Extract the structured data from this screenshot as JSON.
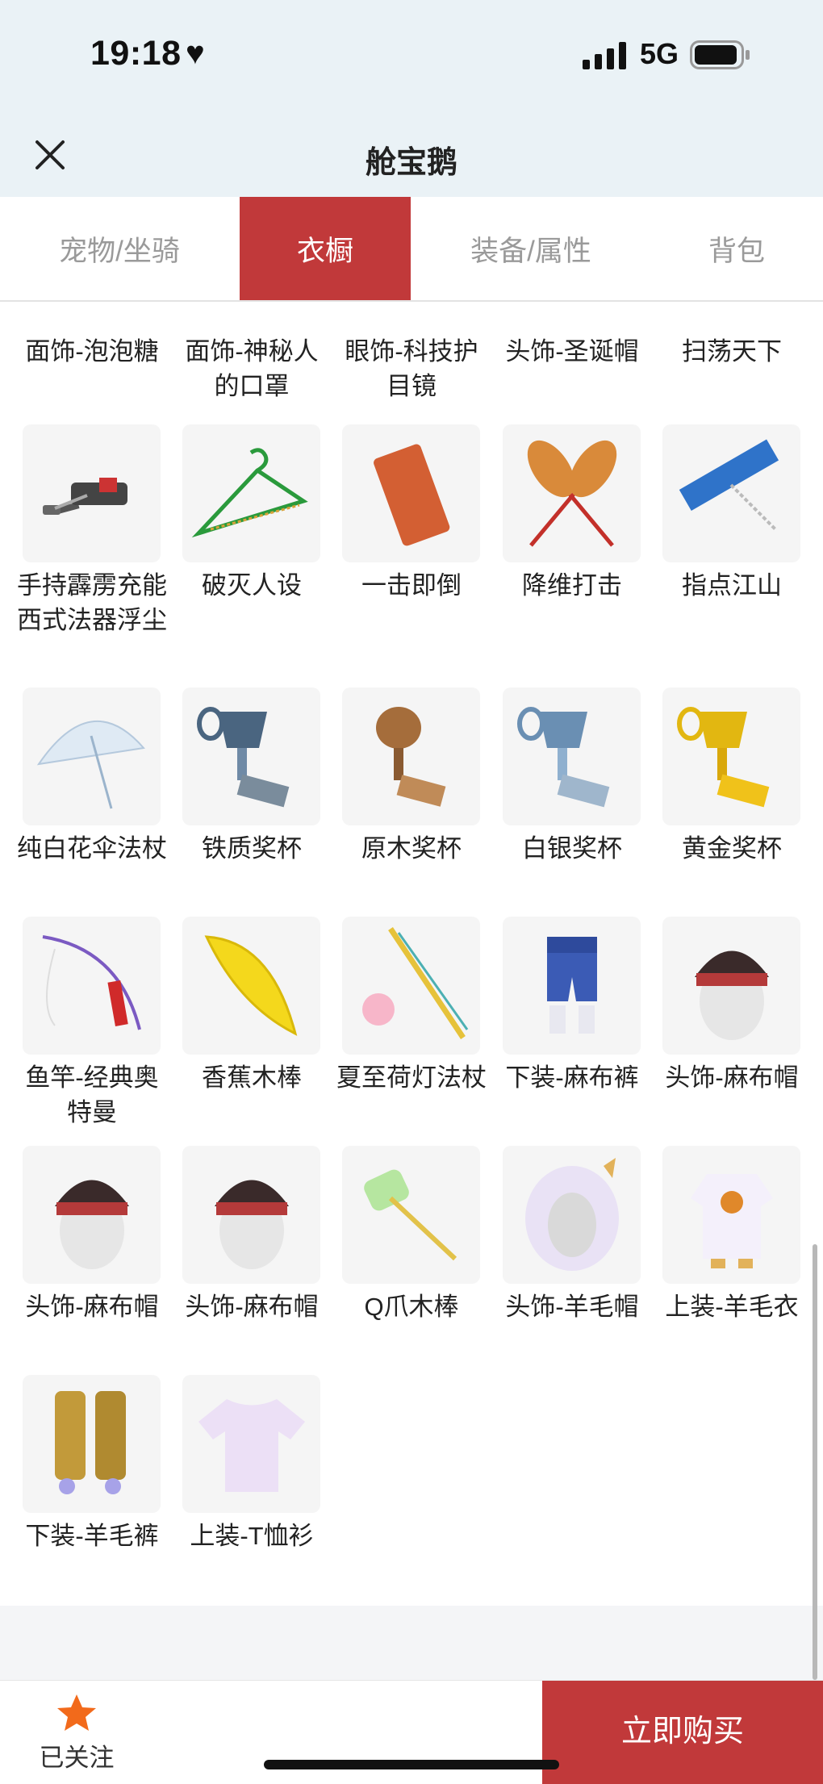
{
  "status_bar": {
    "time": "19:18",
    "network": "5G"
  },
  "header": {
    "title": "舱宝鹅"
  },
  "tabs": [
    {
      "label": "宠物/坐骑",
      "active": false
    },
    {
      "label": "衣橱",
      "active": true
    },
    {
      "label": "装备/属性",
      "active": false
    },
    {
      "label": "背包",
      "active": false
    }
  ],
  "partial_row": [
    "面饰-泡泡糖",
    "面饰-神秘人的口罩",
    "眼饰-科技护目镜",
    "头饰-圣诞帽",
    "扫荡天下"
  ],
  "items": [
    {
      "name": "手持霹雳充能西式法器浮尘",
      "icon": "vacuum-icon"
    },
    {
      "name": "破灭人设",
      "icon": "hanger-icon"
    },
    {
      "name": "一击即倒",
      "icon": "brick-icon"
    },
    {
      "name": "降维打击",
      "icon": "feather-duster-icon"
    },
    {
      "name": "指点江山",
      "icon": "sign-icon"
    },
    {
      "name": "纯白花伞法杖",
      "icon": "umbrella-icon"
    },
    {
      "name": "铁质奖杯",
      "icon": "trophy-icon"
    },
    {
      "name": "原木奖杯",
      "icon": "trophy-icon"
    },
    {
      "name": "白银奖杯",
      "icon": "trophy-icon"
    },
    {
      "name": "黄金奖杯",
      "icon": "trophy-icon"
    },
    {
      "name": "鱼竿-经典奥特曼",
      "icon": "fishing-rod-icon"
    },
    {
      "name": "香蕉木棒",
      "icon": "banana-icon"
    },
    {
      "name": "夏至荷灯法杖",
      "icon": "staff-icon"
    },
    {
      "name": "下装-麻布裤",
      "icon": "pants-icon"
    },
    {
      "name": "头饰-麻布帽",
      "icon": "head-icon"
    },
    {
      "name": "头饰-麻布帽",
      "icon": "head-icon"
    },
    {
      "name": "头饰-麻布帽",
      "icon": "head-icon"
    },
    {
      "name": "Q爪木棒",
      "icon": "hammer-icon"
    },
    {
      "name": "头饰-羊毛帽",
      "icon": "sheep-hat-icon"
    },
    {
      "name": "上装-羊毛衣",
      "icon": "suit-icon"
    },
    {
      "name": "下装-羊毛裤",
      "icon": "boots-icon"
    },
    {
      "name": "上装-T恤衫",
      "icon": "tshirt-icon"
    }
  ],
  "bottom": {
    "follow_label": "已关注",
    "buy_label": "立即购买"
  },
  "colors": {
    "accent": "#c1393a",
    "star": "#f26a1b"
  }
}
